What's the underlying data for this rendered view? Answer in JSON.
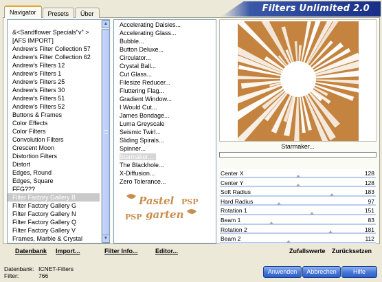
{
  "tabs": [
    "Navigator",
    "Presets",
    "Über"
  ],
  "app_title": "Filters Unlimited 2.0",
  "categories": [
    "&<Sandflower Specials\"v\" >",
    "[AFS IMPORT]",
    "Andrew's Filter Collection 57",
    "Andrew's Filter Collection 62",
    "Andrew's Filters 12",
    "Andrew's Filters 1",
    "Andrew's Filters 25",
    "Andrew's Filters 30",
    "Andrew's Filters 51",
    "Andrew's Filters 52",
    "Buttons & Frames",
    "Color Effects",
    "Color Filters",
    "Convolution Filters",
    "Crescent Moon",
    "Distortion Filters",
    "Distort",
    "Edges, Round",
    "Edges, Square",
    "FFG???",
    "Filter Factory Gallery B",
    "Filter Factory Gallery G",
    "Filter Factory Gallery N",
    "Filter Factory Gallery Q",
    "Filter Factory Gallery V",
    "Frames, Marble & Crystal"
  ],
  "categories_selected_index": 20,
  "filters": [
    "Accelerating Daisies...",
    "Accelerating Glass...",
    "Bubble...",
    "Button Deluxe...",
    "Circulator...",
    "Crystal Ball...",
    "Cut Glass...",
    "Filesize Reducer...",
    "Fluttering Flag...",
    "Gradient Window...",
    "I Would Cut...",
    "James Bondage...",
    "Luma Greyscale",
    "Seismic Twirl...",
    "Sliding Spirals...",
    "Spinner...",
    "Starmaker...",
    "The Blackhole...",
    "X-Diffusion...",
    "Zero Tolerance..."
  ],
  "filters_selected_index": 16,
  "preview": {
    "filter_name": "Starmaker...",
    "bg_color": "#c4843f",
    "ray_color": "#ffffff"
  },
  "watermark": {
    "line1": "Pastel",
    "line2": "garten",
    "badge": "PSP",
    "color": "#c98d4e"
  },
  "params": [
    {
      "name": "Center X",
      "value": "128",
      "pos": 0.5
    },
    {
      "name": "Center Y",
      "value": "128",
      "pos": 0.5
    },
    {
      "name": "Soft Radius",
      "value": "183",
      "pos": 0.72
    },
    {
      "name": "Hard Radius",
      "value": "97",
      "pos": 0.38
    },
    {
      "name": "Rotation 1",
      "value": "151",
      "pos": 0.59
    },
    {
      "name": "Beam 1",
      "value": "83",
      "pos": 0.33
    },
    {
      "name": "Rotation 2",
      "value": "181",
      "pos": 0.71
    },
    {
      "name": "Beam 2",
      "value": "112",
      "pos": 0.44
    }
  ],
  "bottom_links": {
    "datenbank": "Datenbank",
    "import": "Import...",
    "filter_info": "Filter Info...",
    "editor": "Editor...",
    "zufallswerte": "Zufallswerte",
    "zuruecksetzen": "Zurücksetzen"
  },
  "status": {
    "datenbank_label": "Datenbank:",
    "datenbank_value": "ICNET-Filters",
    "filter_label": "Filter:",
    "filter_value": "766"
  },
  "buttons": {
    "apply": "Anwenden",
    "cancel": "Abbrechen",
    "help": "Hilfe"
  }
}
